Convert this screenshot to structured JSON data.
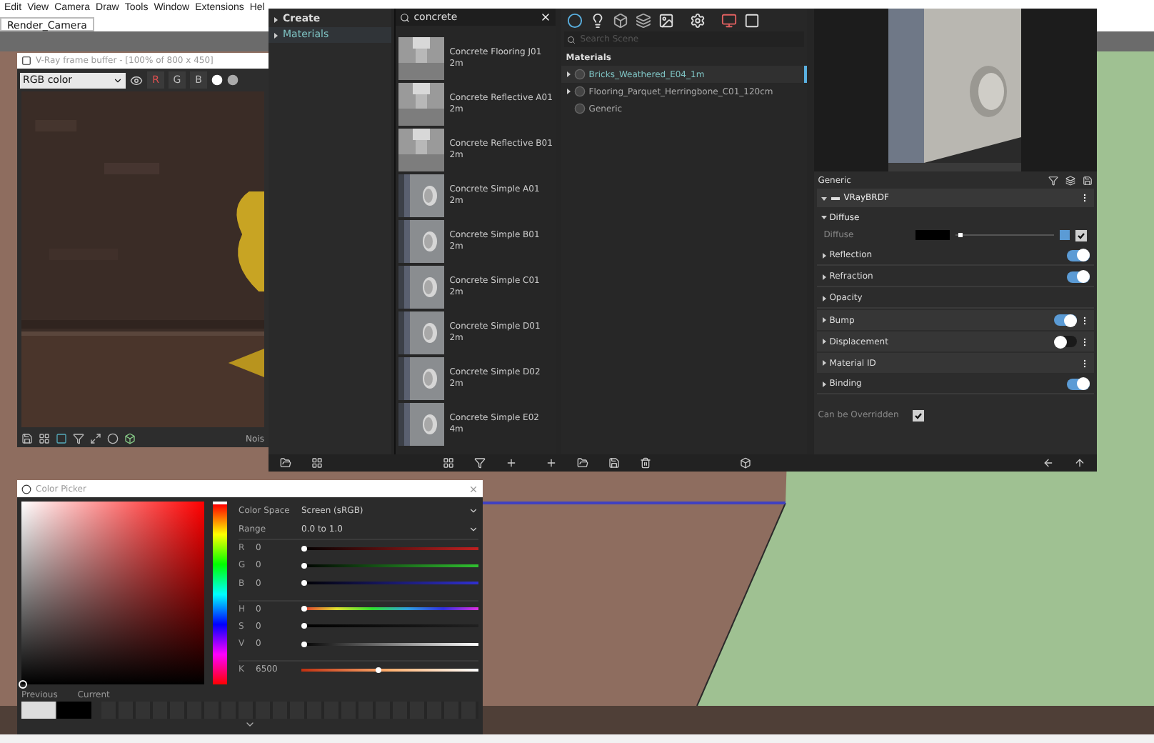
{
  "menu_bar": [
    "Edit",
    "View",
    "Camera",
    "Draw",
    "Tools",
    "Window",
    "Extensions",
    "Hel"
  ],
  "scene_tabs": [
    {
      "label": "Render_Camera",
      "selected": true
    }
  ],
  "frame_buffer": {
    "title": "V-Ray frame buffer - [100% of 800 x 450]",
    "channel": "RGB color",
    "channel_buttons": [
      "R",
      "G",
      "B"
    ],
    "status": "Nois"
  },
  "asset_editor": {
    "categories": [
      {
        "label": "Create",
        "selected": false
      },
      {
        "label": "Materials",
        "selected": true
      }
    ],
    "library_search": {
      "value": "concrete"
    },
    "library_items": [
      {
        "label": "Concrete Flooring J01 2m",
        "kind": "floor"
      },
      {
        "label": "Concrete Reflective A01 2m",
        "kind": "floor"
      },
      {
        "label": "Concrete Reflective B01 2m",
        "kind": "floor"
      },
      {
        "label": "Concrete Simple A01 2m",
        "kind": "sample"
      },
      {
        "label": "Concrete Simple B01 2m",
        "kind": "sample"
      },
      {
        "label": "Concrete Simple C01 2m",
        "kind": "sample"
      },
      {
        "label": "Concrete Simple D01 2m",
        "kind": "sample"
      },
      {
        "label": "Concrete Simple D02 2m",
        "kind": "sample"
      },
      {
        "label": "Concrete Simple E02 4m",
        "kind": "sample"
      }
    ],
    "scene_search": {
      "placeholder": "Search Scene"
    },
    "scene_heading": "Materials",
    "scene_items": [
      {
        "label": "Bricks_Weathered_E04_1m",
        "selected": true,
        "expandable": true
      },
      {
        "label": "Flooring_Parquet_Herringbone_C01_120cm",
        "selected": false,
        "expandable": true
      },
      {
        "label": "Generic",
        "selected": false,
        "expandable": false
      }
    ],
    "material_name": "Generic",
    "brdf": "VRayBRDF",
    "diffuse": {
      "heading": "Diffuse",
      "label": "Diffuse",
      "checked": true,
      "level": 0.03
    },
    "sections": [
      {
        "label": "Reflection",
        "kind": "toggle",
        "on": true,
        "menu": false
      },
      {
        "label": "Refraction",
        "kind": "toggle",
        "on": true,
        "menu": false
      },
      {
        "label": "Opacity",
        "kind": "plain",
        "menu": false
      },
      {
        "label": "Bump",
        "kind": "toggle",
        "on": true,
        "menu": true
      },
      {
        "label": "Displacement",
        "kind": "toggle",
        "on": false,
        "menu": true
      },
      {
        "label": "Material ID",
        "kind": "plain",
        "menu": true
      },
      {
        "label": "Binding",
        "kind": "toggle",
        "on": true,
        "menu": false
      }
    ],
    "can_be_overridden": {
      "label": "Can be Overridden",
      "checked": true
    }
  },
  "color_picker": {
    "title": "Color Picker",
    "color_space": {
      "label": "Color Space",
      "value": "Screen (sRGB)"
    },
    "range": {
      "label": "Range",
      "value": "0.0 to 1.0"
    },
    "channels": [
      {
        "label": "R",
        "value": "0",
        "level": 0,
        "kind": "red"
      },
      {
        "label": "G",
        "value": "0",
        "level": 0,
        "kind": "green"
      },
      {
        "label": "B",
        "value": "0",
        "level": 0,
        "kind": "blue"
      },
      {
        "label": "H",
        "value": "0",
        "level": 0,
        "kind": "hue"
      },
      {
        "label": "S",
        "value": "0",
        "level": 0,
        "kind": "gray"
      },
      {
        "label": "V",
        "value": "0",
        "level": 0,
        "kind": "white"
      },
      {
        "label": "K",
        "value": "6500",
        "level": 0.42,
        "kind": "temperature"
      }
    ],
    "swatch_labels": [
      "Previous",
      "Current"
    ]
  }
}
